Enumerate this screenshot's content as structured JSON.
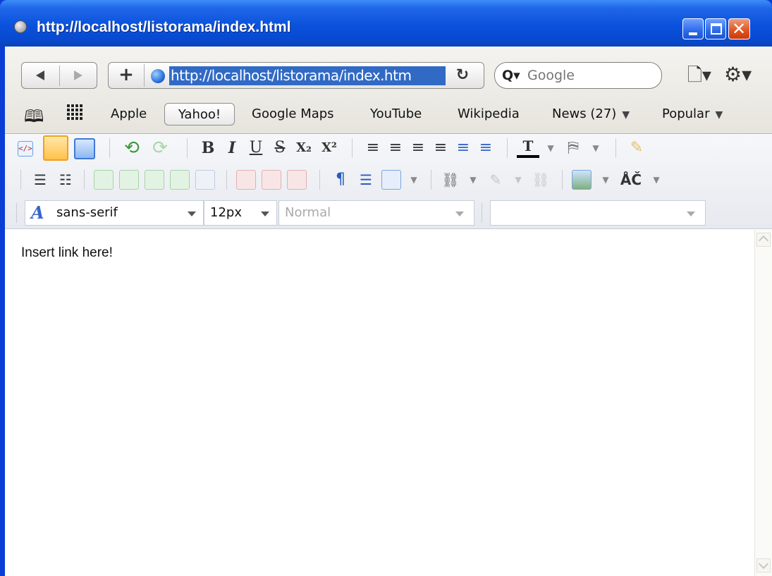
{
  "window": {
    "title": "http://localhost/listorama/index.html"
  },
  "nav": {
    "url": "http://localhost/listorama/index.htm",
    "add_label": "+",
    "reload_glyph": "↻",
    "search_placeholder": "Google",
    "search_glyph": "Q▾",
    "page_menu_glyph": "🗋▾",
    "gear_menu_glyph": "⚙▾"
  },
  "bookmarks": {
    "items": [
      {
        "label": "Apple"
      },
      {
        "label": "Yahoo!"
      },
      {
        "label": "Google Maps"
      },
      {
        "label": "YouTube"
      },
      {
        "label": "Wikipedia"
      },
      {
        "label": "News (27)"
      },
      {
        "label": "Popular"
      }
    ],
    "caret": "▼"
  },
  "editor": {
    "toolbar": {
      "bold": "B",
      "italic": "I",
      "underline": "U",
      "strike": "S",
      "subscript": "X₂",
      "superscript": "X²",
      "paragraph": "¶",
      "special_chars": "ÅČ"
    },
    "font_family": "sans-serif",
    "font_size": "12px",
    "format": "Normal",
    "style": "",
    "content": "Insert link here!"
  },
  "colors": {
    "title_bar": "#0a52dc",
    "url_selection": "#316ac5",
    "close_button": "#e0531f"
  }
}
